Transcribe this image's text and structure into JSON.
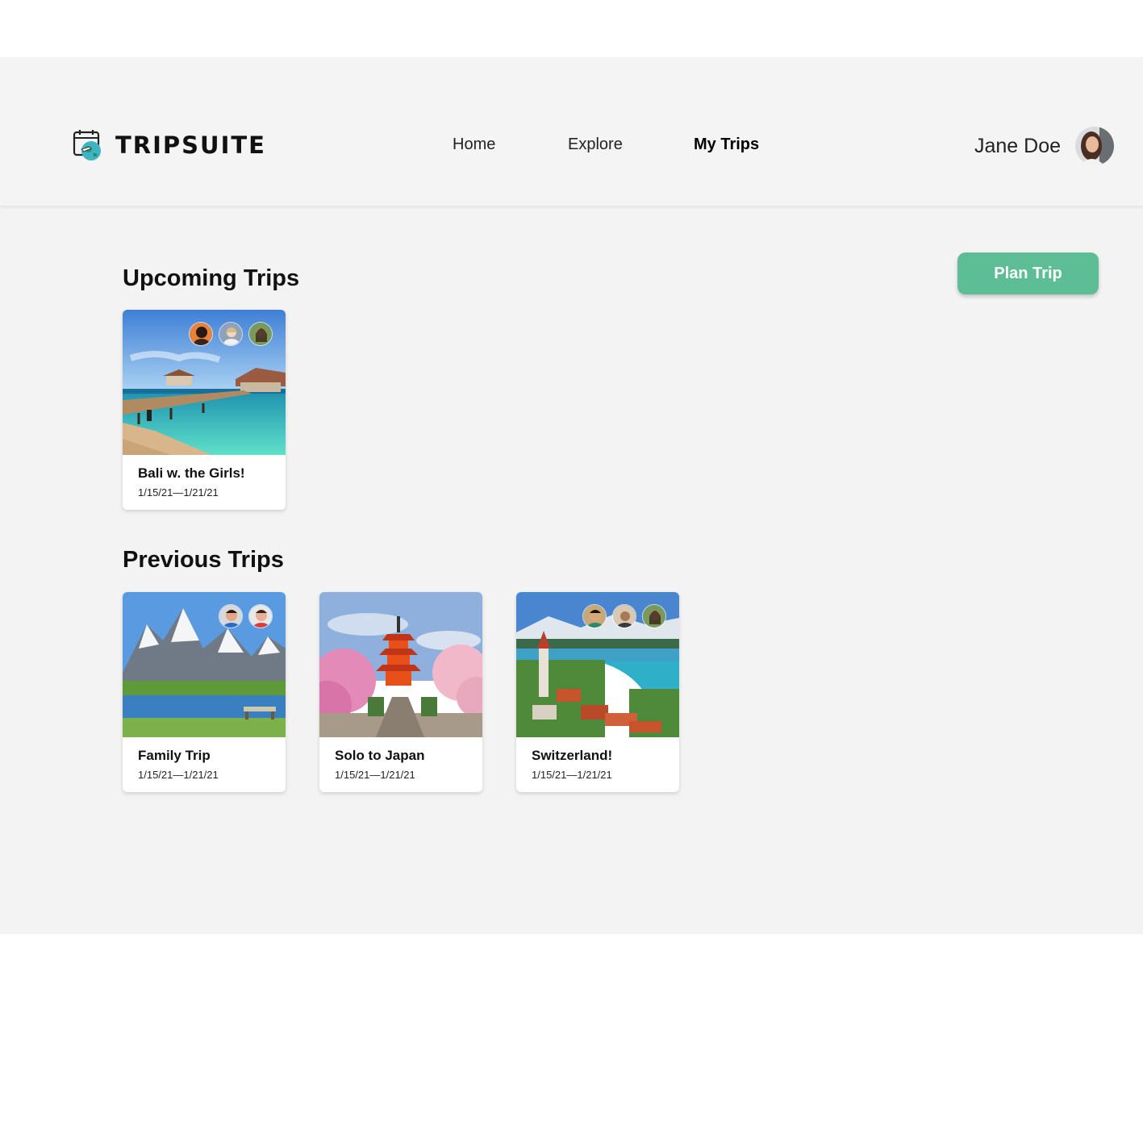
{
  "app": {
    "name": "TRIPSUITE",
    "logo_icon": "calendar-globe-icon"
  },
  "nav": {
    "items": [
      {
        "label": "Home",
        "active": false
      },
      {
        "label": "Explore",
        "active": false
      },
      {
        "label": "My Trips",
        "active": true
      }
    ]
  },
  "user": {
    "name": "Jane Doe"
  },
  "actions": {
    "plan_trip_label": "Plan Trip"
  },
  "colors": {
    "accent": "#5dbd95",
    "background": "#f3f3f3",
    "card": "#ffffff"
  },
  "sections": {
    "upcoming": {
      "title": "Upcoming Trips",
      "trips": [
        {
          "title": "Bali w. the Girls!",
          "dates": "1/15/21—1/21/21",
          "image": "tropical-pier-photo",
          "members": 3
        }
      ]
    },
    "previous": {
      "title": "Previous Trips",
      "trips": [
        {
          "title": "Family Trip",
          "dates": "1/15/21—1/21/21",
          "image": "alpine-lake-photo",
          "members": 2
        },
        {
          "title": "Solo to Japan",
          "dates": "1/15/21—1/21/21",
          "image": "pagoda-cherry-blossom-photo",
          "members": 0
        },
        {
          "title": "Switzerland!",
          "dates": "1/15/21—1/21/21",
          "image": "swiss-town-lake-photo",
          "members": 3
        }
      ]
    }
  }
}
